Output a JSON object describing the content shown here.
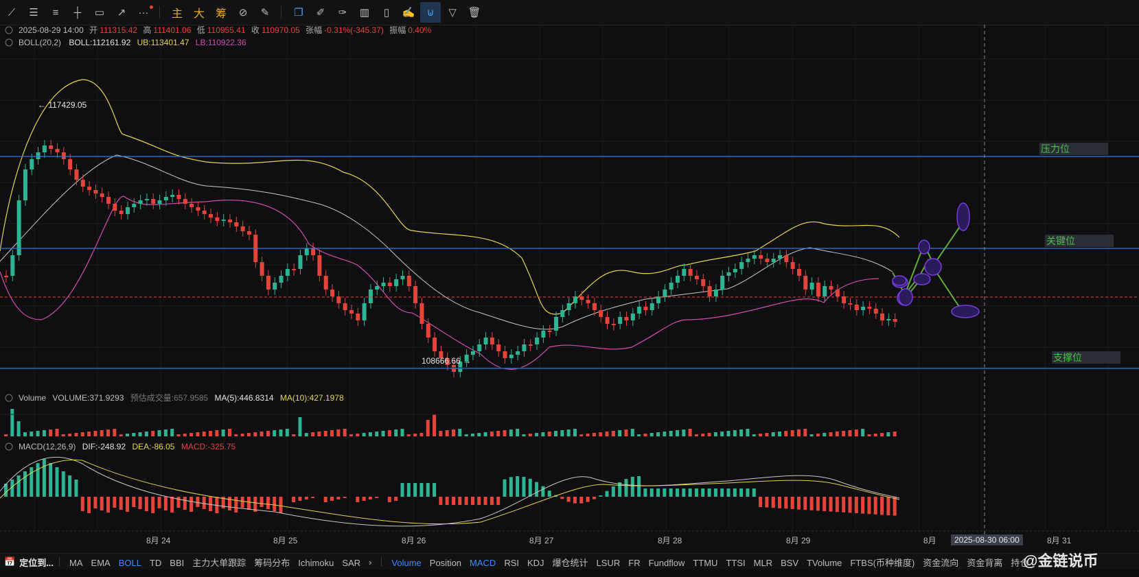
{
  "toolbar": {
    "left_icons": [
      "trend-line-icon",
      "horizontal-lines-icon",
      "parallel-lines-icon",
      "cross-line-icon",
      "rectangle-icon",
      "ray-icon",
      "more-icon"
    ],
    "cn_buttons": [
      "主",
      "大",
      "筹"
    ],
    "right_icons": [
      "calc-icon",
      "measure-icon",
      "hide-drawings-icon",
      "indicator-compare-icon",
      "trash-doc-icon",
      "note-icon",
      "magnet-icon",
      "filter-icon",
      "delete-icon"
    ]
  },
  "ohlc": {
    "datetime": "2025-08-29 14:00",
    "open_label": "开",
    "open": "111315.42",
    "high_label": "高",
    "high": "111401.06",
    "low_label": "低",
    "low": "110955.41",
    "close_label": "收",
    "close": "110970.05",
    "change_label": "张幅",
    "change": "-0.31%(-345.37)",
    "amplitude_label": "振幅",
    "amplitude": "0.40%"
  },
  "boll": {
    "name": "BOLL(20,2)",
    "mid": "BOLL:112161.92",
    "ub": "UB:113401.47",
    "lb": "LB:110922.36"
  },
  "price_labels": {
    "high": "117429.05",
    "low": "108666.66"
  },
  "levels": {
    "resistance": "压力位",
    "key": "关键位",
    "support": "支撑位"
  },
  "volume": {
    "name": "Volume",
    "value": "VOLUME:371.9293",
    "est": "预估成交量:657.9585",
    "ma5": "MA(5):446.8314",
    "ma10": "MA(10):427.1978"
  },
  "macd": {
    "name": "MACD(12,26,9)",
    "dif": "DIF:-248.92",
    "dea": "DEA:-86.05",
    "macd": "MACD:-325.75"
  },
  "xaxis": [
    "8月 24",
    "8月 25",
    "8月 26",
    "8月 27",
    "8月 28",
    "8月 29",
    "8月",
    "8月 31"
  ],
  "crosshair_time": "2025-08-30 06:00",
  "bottom_bar": {
    "locate": "定位到...",
    "main_indicators": [
      "MA",
      "EMA",
      "BOLL",
      "TD",
      "BBI",
      "主力大单跟踪",
      "筹码分布",
      "Ichimoku",
      "SAR"
    ],
    "main_active": "BOLL",
    "sub_indicators": [
      "Volume",
      "Position",
      "MACD",
      "RSI",
      "KDJ",
      "爆仓统计",
      "LSUR",
      "FR",
      "Fundflow",
      "TTMU",
      "TTSI",
      "MLR",
      "BSV",
      "TVolume",
      "FTBS(币种维度)",
      "资金流向",
      "资金背离",
      "持仓"
    ],
    "sub_active": [
      "Volume",
      "MACD"
    ]
  },
  "watermark": "@金链说币",
  "colors": {
    "up": "#2db593",
    "down": "#e5443b",
    "boll_ub": "#e8d44d",
    "boll_lb": "#d24bb3",
    "boll_mid": "#c8c8c8",
    "level_line": "#2f7be0",
    "level_text": "#46c24a",
    "accent": "#3d8bff",
    "ellipse": "#6a2bc4",
    "arrow": "#5fae3b"
  }
}
